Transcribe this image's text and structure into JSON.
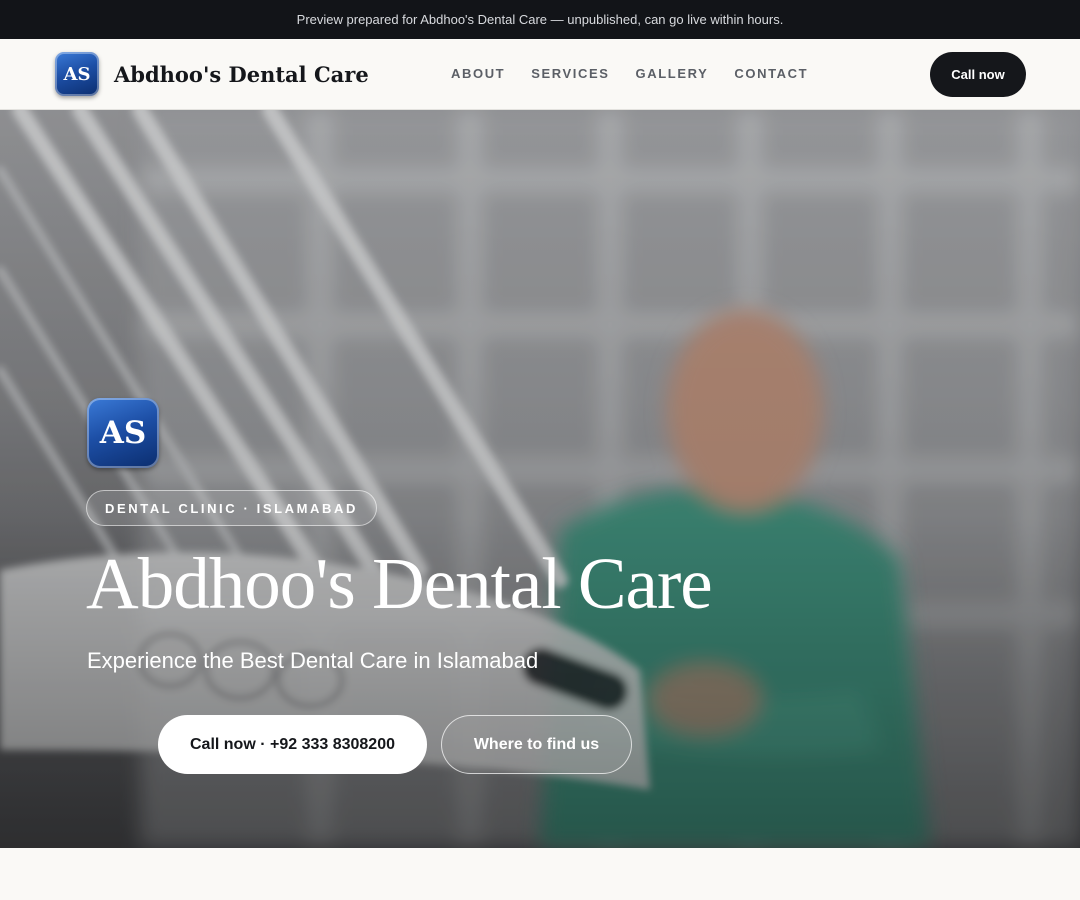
{
  "preview_banner": {
    "text": "Preview prepared for Abdhoo's Dental Care — unpublished, can go live within hours."
  },
  "header": {
    "logo_text": "AS",
    "brand_name": "Abdhoo's Dental Care",
    "nav": [
      {
        "label": "ABOUT"
      },
      {
        "label": "SERVICES"
      },
      {
        "label": "GALLERY"
      },
      {
        "label": "CONTACT"
      }
    ],
    "cta_label": "Call now"
  },
  "hero": {
    "logo_text": "AS",
    "tag": "DENTAL CLINIC · ISLAMABAD",
    "title": "Abdhoo's Dental Care",
    "subtitle": "Experience the Best Dental Care in Islamabad",
    "primary_button": "Call now · +92 333 8308200",
    "secondary_button": "Where to find us"
  },
  "colors": {
    "dark": "#15171b",
    "logo_blue": "#1d4fa6",
    "scrub_green": "#3f8f7c",
    "page_bg": "#faf9f6"
  }
}
